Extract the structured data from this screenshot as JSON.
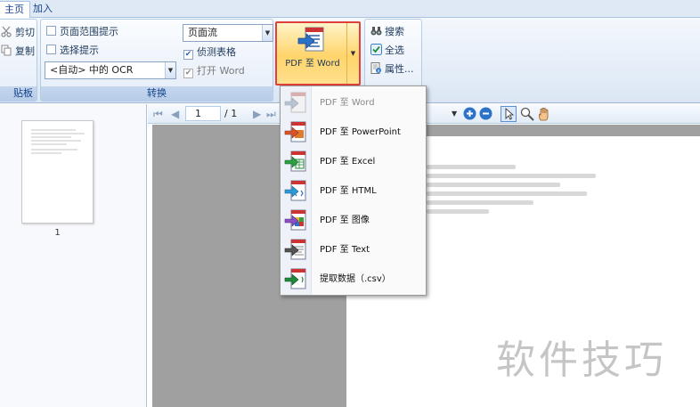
{
  "tabs": [
    {
      "label": "主页",
      "active": true
    },
    {
      "label": "加入",
      "active": false
    }
  ],
  "clipboard": {
    "cut_label": "剪切",
    "copy_label": "复制",
    "caption_partial": "贴板"
  },
  "convert": {
    "caption": "转换",
    "page_range_label": "页面范围提示",
    "select_prompt_label": "选择提示",
    "ocr_value": "<自动> 中的 OCR",
    "layout_value": "页面流",
    "detect_tables_label": "侦测表格",
    "detect_tables_checked": true,
    "open_word_label": "打开 Word",
    "open_word_checked": true
  },
  "big_button": {
    "label": "PDF 至 Word"
  },
  "tools": {
    "search_label": "搜索",
    "select_all_label": "全选",
    "properties_label": "属性..."
  },
  "navigation": {
    "current_page": "1",
    "total_pages": "/ 1"
  },
  "thumbnail": {
    "page_number": "1"
  },
  "menu_items": [
    {
      "label": "PDF 至 Word",
      "disabled": true,
      "icon": "word-convert-icon"
    },
    {
      "label": "PDF 至 PowerPoint",
      "disabled": false,
      "icon": "powerpoint-convert-icon"
    },
    {
      "label": "PDF 至 Excel",
      "disabled": false,
      "icon": "excel-convert-icon"
    },
    {
      "label": "PDF 至 HTML",
      "disabled": false,
      "icon": "html-convert-icon"
    },
    {
      "label": "PDF 至 图像",
      "disabled": false,
      "icon": "image-convert-icon"
    },
    {
      "label": "PDF 至 Text",
      "disabled": false,
      "icon": "text-convert-icon"
    },
    {
      "label": "提取数据（.csv）",
      "disabled": false,
      "icon": "csv-extract-icon"
    }
  ],
  "watermark": "软件技巧",
  "colors": {
    "ribbon_text": "#15428b",
    "highlight_border": "#e2403a",
    "button_fill": "#ffd46a"
  }
}
